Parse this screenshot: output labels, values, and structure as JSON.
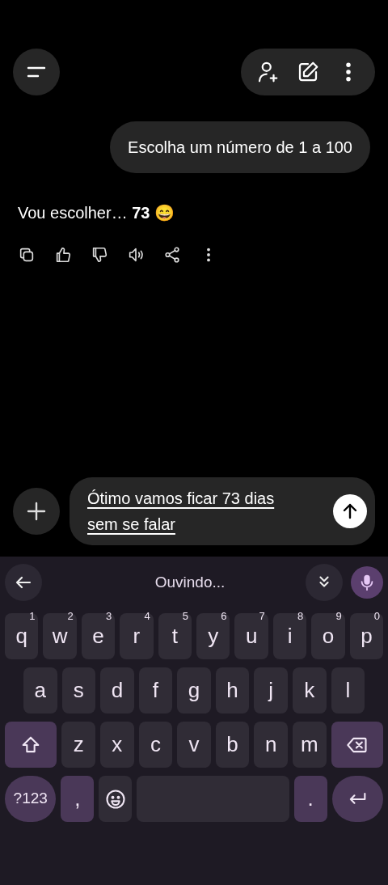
{
  "prompt": {
    "text": "Escolha um número de 1 a 100"
  },
  "response": {
    "text": "Vou escolher… **73** 😄"
  },
  "compose": {
    "value": "Ótimo vamos ficar 73 dias sem se falar"
  },
  "keyboard": {
    "status": "Ouvindo...",
    "mic_on": true,
    "key_rows": [
      [
        {
          "kind": "letter",
          "label": "q",
          "hint": "1"
        },
        {
          "kind": "letter",
          "label": "w",
          "hint": "2"
        },
        {
          "kind": "letter",
          "label": "e",
          "hint": "3"
        },
        {
          "kind": "letter",
          "label": "r",
          "hint": "4"
        },
        {
          "kind": "letter",
          "label": "t",
          "hint": "5"
        },
        {
          "kind": "letter",
          "label": "y",
          "hint": "6"
        },
        {
          "kind": "letter",
          "label": "u",
          "hint": "7"
        },
        {
          "kind": "letter",
          "label": "i",
          "hint": "8"
        },
        {
          "kind": "letter",
          "label": "o",
          "hint": "9"
        },
        {
          "kind": "letter",
          "label": "p",
          "hint": "0"
        }
      ],
      [
        {
          "kind": "letter",
          "label": "a"
        },
        {
          "kind": "letter",
          "label": "s"
        },
        {
          "kind": "letter",
          "label": "d"
        },
        {
          "kind": "letter",
          "label": "f"
        },
        {
          "kind": "letter",
          "label": "g"
        },
        {
          "kind": "letter",
          "label": "h"
        },
        {
          "kind": "letter",
          "label": "j"
        },
        {
          "kind": "letter",
          "label": "k"
        },
        {
          "kind": "letter",
          "label": "l"
        }
      ],
      [
        {
          "kind": "shift"
        },
        {
          "kind": "letter",
          "label": "z"
        },
        {
          "kind": "letter",
          "label": "x"
        },
        {
          "kind": "letter",
          "label": "c"
        },
        {
          "kind": "letter",
          "label": "v"
        },
        {
          "kind": "letter",
          "label": "b"
        },
        {
          "kind": "letter",
          "label": "n"
        },
        {
          "kind": "letter",
          "label": "m"
        },
        {
          "kind": "backspace"
        }
      ]
    ],
    "bottom_row": [
      {
        "kind": "symbols",
        "label": "?123"
      },
      {
        "kind": "comma",
        "label": ","
      },
      {
        "kind": "emoji"
      },
      {
        "kind": "space"
      },
      {
        "kind": "period",
        "label": "."
      },
      {
        "kind": "enter"
      }
    ]
  }
}
